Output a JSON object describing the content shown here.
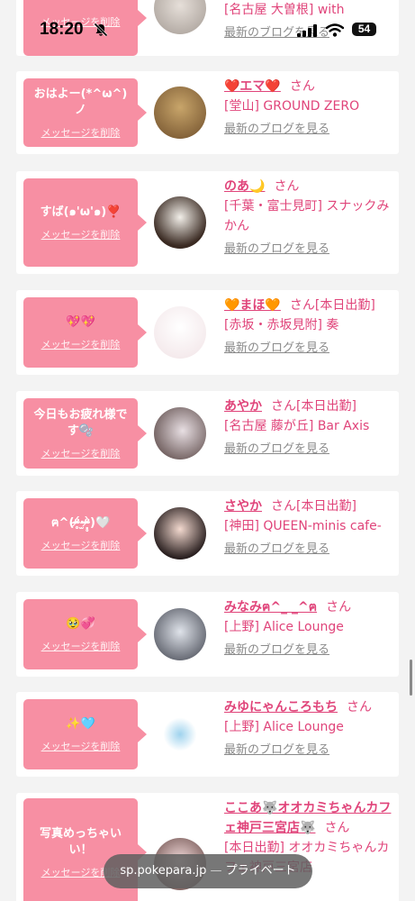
{
  "status_bar": {
    "time": "18:20",
    "battery": "54"
  },
  "url_bar": {
    "domain": "sp.pokepara.jp",
    "separator": "—",
    "mode": "プライベート"
  },
  "delete_label": "メッセージを削除",
  "blog_label": "最新のブログを見る",
  "san_label": "さん",
  "messages": [
    {
      "message": "",
      "name": "",
      "shift": "",
      "shop": "[名古屋 大曽根] with",
      "show_san": false
    },
    {
      "message": "おはよー(*^ω^)ノ",
      "name": "❤️エマ❤️",
      "shift": "",
      "shop": "[堂山] GROUND ZERO",
      "show_san": true
    },
    {
      "message": "すば(๑'ω'๑)❣️",
      "name": "のあ🌙",
      "shift": "",
      "shop": "[千葉・富士見町] スナックみかん",
      "show_san": true
    },
    {
      "message": "💖💖",
      "name": "🧡まほ🧡",
      "shift": "[本日出勤]",
      "shop": "[赤坂・赤坂見附] 奏",
      "show_san": true
    },
    {
      "message": "今日もお疲れ様です🫧",
      "name": "あやか",
      "shift": "[本日出勤]",
      "shop": "[名古屋 藤が丘] Bar Axis",
      "show_san": true
    },
    {
      "message": "ฅ^(ᵒ̴̶̷̥́·̫ᵒ̴̶̷̣̥̀)🤍",
      "name": "さやか",
      "shift": "[本日出勤]",
      "shop": "[神田] QUEEN-minis cafe-",
      "show_san": true
    },
    {
      "message": "🥹💞",
      "name": "みなみฅ^_ _^ฅ",
      "shift": "",
      "shop": "[上野] Alice Lounge",
      "show_san": true
    },
    {
      "message": "✨🩵",
      "name": "みゆにゃんころもち",
      "shift": "",
      "shop": "[上野] Alice Lounge",
      "show_san": true
    },
    {
      "message": "写真めっちゃいい！",
      "name": "ここあ🐺オオカミちゃんカフェ神戸三宮店🐺",
      "shift": "",
      "shop": "[本日出勤] オオカミちゃんカフェ神戸三宮店",
      "show_san": true
    }
  ]
}
